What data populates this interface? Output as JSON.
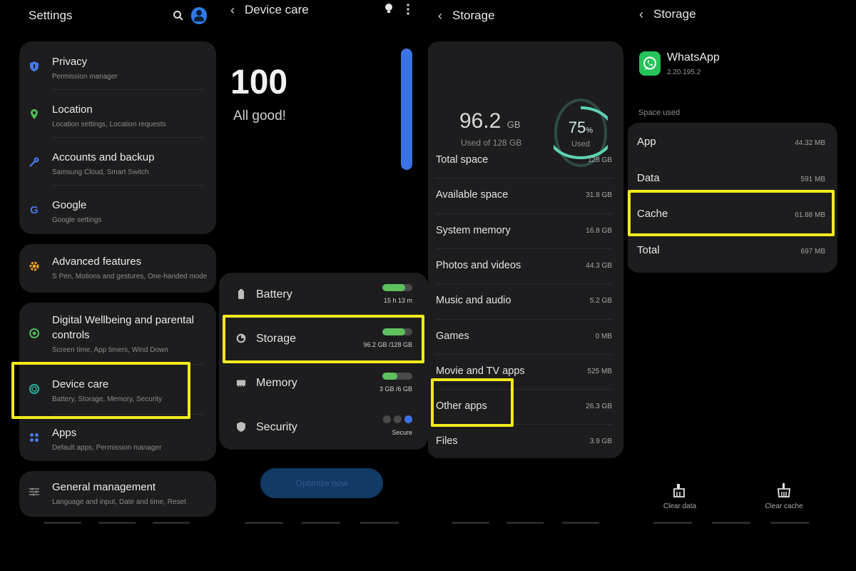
{
  "colors": {
    "highlight": "#f3ea1d",
    "accent_blue": "#3b73e6",
    "green": "#5ec15e",
    "whatsapp": "#25c45a"
  },
  "settings": {
    "title": "Settings",
    "items": [
      {
        "title": "Privacy",
        "subtitle": "Permission manager",
        "icon": "shield-icon"
      },
      {
        "title": "Location",
        "subtitle": "Location settings, Location requests",
        "icon": "location-pin-icon"
      },
      {
        "title": "Accounts and backup",
        "subtitle": "Samsung Cloud, Smart Switch",
        "icon": "key-icon"
      },
      {
        "title": "Google",
        "subtitle": "Google settings",
        "icon": "google-icon"
      },
      {
        "title": "Advanced features",
        "subtitle": "S Pen, Motions and gestures, One-handed mode",
        "icon": "gear-plus-icon"
      },
      {
        "title": "Digital Wellbeing and parental",
        "title2": "controls",
        "subtitle": "Screen time, App timers, Wind Down",
        "icon": "wellbeing-icon"
      },
      {
        "title": "Device care",
        "subtitle": "Battery, Storage, Memory, Security",
        "icon": "device-care-icon"
      },
      {
        "title": "Apps",
        "subtitle": "Default apps, Permission manager",
        "icon": "apps-grid-icon"
      },
      {
        "title": "General management",
        "subtitle": "Language and input, Date and time, Reset",
        "icon": "sliders-icon"
      }
    ]
  },
  "device_care": {
    "title": "Device care",
    "score": "100",
    "status": "All good!",
    "rows": [
      {
        "label": "Battery",
        "value": "15 h 13 m",
        "fill": 0.75
      },
      {
        "label": "Storage",
        "value": "96.2 GB /128 GB",
        "fill": 0.75
      },
      {
        "label": "Memory",
        "value": "3 GB /6 GB",
        "fill": 0.5
      },
      {
        "label": "Security",
        "value": "Secure"
      }
    ],
    "optimize_label": "Optimize now"
  },
  "storage": {
    "title": "Storage",
    "used_value": "96.2",
    "used_unit": "GB",
    "used_of": "Used of 128 GB",
    "percent": "75",
    "percent_sign": "%",
    "percent_label": "Used",
    "percent_fraction": 0.75,
    "rows": [
      {
        "label": "Total space",
        "value": "128 GB"
      },
      {
        "label": "Available space",
        "value": "31.8 GB"
      },
      {
        "label": "System memory",
        "value": "16.8 GB"
      },
      {
        "label": "Photos and videos",
        "value": "44.3 GB"
      },
      {
        "label": "Music and audio",
        "value": "5.2 GB"
      },
      {
        "label": "Games",
        "value": "0 MB"
      },
      {
        "label": "Movie and TV apps",
        "value": "525 MB"
      },
      {
        "label": "Other apps",
        "value": "26.3 GB"
      },
      {
        "label": "Files",
        "value": "3.9 GB"
      }
    ]
  },
  "app_storage": {
    "title": "Storage",
    "app_name": "WhatsApp",
    "version": "2.20.195.2",
    "section_label": "Space used",
    "rows": [
      {
        "label": "App",
        "value": "44.32 MB"
      },
      {
        "label": "Data",
        "value": "591 MB"
      },
      {
        "label": "Cache",
        "value": "61.88 MB"
      },
      {
        "label": "Total",
        "value": "697 MB"
      }
    ],
    "clear_data": "Clear data",
    "clear_cache": "Clear cache"
  }
}
